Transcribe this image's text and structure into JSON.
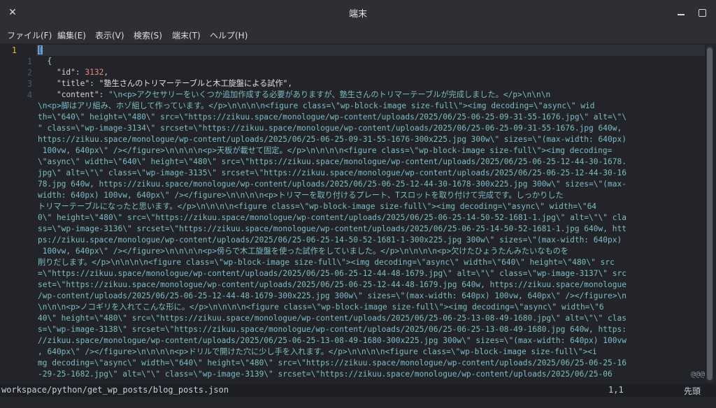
{
  "window": {
    "title": "端末"
  },
  "titlebar": {
    "close_glyph": "✕"
  },
  "menu": [
    "ファイル(F)",
    "編集(E)",
    "表示(V)",
    "検索(S)",
    "端末(T)",
    "ヘルプ(H)"
  ],
  "gutter": {
    "current_line": "1",
    "relative_numbers": [
      "1",
      "2",
      "3",
      "4"
    ]
  },
  "code": {
    "line1_bracket": "[",
    "line2": "  {",
    "line3_key": "\"id\"",
    "line3_sep": ": ",
    "line3_value": "3132",
    "line3_end": ",",
    "line4_key": "\"title\"",
    "line4_sep": ": ",
    "line4_value": "\"塾生さんのトリマーテーブルと木工旋盤による試作\"",
    "line4_end": ",",
    "line5_key": "\"content\"",
    "line5_sep": ": ",
    "line5_value": "\"\\n<p>アクセサリーをいくつか追加作成する必要がありますが、塾生さんのトリマーテーブルが完成しました。</p>\\n\\n\\n",
    "wrap_lines": [
      "\\n<p>脚はアリ組み、ホゾ組して作っています。</p>\\n\\n\\n\\n<figure class=\\\"wp-block-image size-full\\\"><img decoding=\\\"async\\\" wid",
      "th=\\\"640\\\" height=\\\"480\\\" src=\\\"https://zikuu.space/monologue/wp-content/uploads/2025/06/25-06-25-09-31-55-1676.jpg\\\" alt=\\\"\\",
      "\" class=\\\"wp-image-3134\\\" srcset=\\\"https://zikuu.space/monologue/wp-content/uploads/2025/06/25-06-25-09-31-55-1676.jpg 640w,",
      "https://zikuu.space/monologue/wp-content/uploads/2025/06/25-06-25-09-31-55-1676-300x225.jpg 300w\\\" sizes=\\\"(max-width: 640px)",
      " 100vw, 640px\\\" /></figure>\\n\\n\\n\\n<p>天板が載せて固定。</p>\\n\\n\\n\\n<figure class=\\\"wp-block-image size-full\\\"><img decoding=",
      "\\\"async\\\" width=\\\"640\\\" height=\\\"480\\\" src=\\\"https://zikuu.space/monologue/wp-content/uploads/2025/06/25-06-25-12-44-30-1678.",
      "jpg\\\" alt=\\\"\\\" class=\\\"wp-image-3135\\\" srcset=\\\"https://zikuu.space/monologue/wp-content/uploads/2025/06/25-06-25-12-44-30-16",
      "78.jpg 640w, https://zikuu.space/monologue/wp-content/uploads/2025/06/25-06-25-12-44-30-1678-300x225.jpg 300w\\\" sizes=\\\"(max-",
      "width: 640px) 100vw, 640px\\\" /></figure>\\n\\n\\n\\n<p>トリマーを取り付けるプレート、Tスロットを取り付けて完成です。しっかりした",
      "トリマーテーブルになったと思います。</p>\\n\\n\\n\\n<figure class=\\\"wp-block-image size-full\\\"><img decoding=\\\"async\\\" width=\\\"64",
      "0\\\" height=\\\"480\\\" src=\\\"https://zikuu.space/monologue/wp-content/uploads/2025/06/25-06-25-14-50-52-1681-1.jpg\\\" alt=\\\"\\\" cla",
      "ss=\\\"wp-image-3136\\\" srcset=\\\"https://zikuu.space/monologue/wp-content/uploads/2025/06/25-06-25-14-50-52-1681-1.jpg 640w, htt",
      "ps://zikuu.space/monologue/wp-content/uploads/2025/06/25-06-25-14-50-52-1681-1-300x225.jpg 300w\\\" sizes=\\\"(max-width: 640px)",
      " 100vw, 640px\\\" /></figure>\\n\\n\\n\\n<p>傍らで木工旋盤を使った試作をしていました。</p>\\n\\n\\n\\n<p>欠けたひょうたんみたいなものを",
      "削りだします。</p>\\n\\n\\n\\n<figure class=\\\"wp-block-image size-full\\\"><img decoding=\\\"async\\\" width=\\\"640\\\" height=\\\"480\\\" src",
      "=\\\"https://zikuu.space/monologue/wp-content/uploads/2025/06/25-06-25-12-44-48-1679.jpg\\\" alt=\\\"\\\" class=\\\"wp-image-3137\\\" src",
      "set=\\\"https://zikuu.space/monologue/wp-content/uploads/2025/06/25-06-25-12-44-48-1679.jpg 640w, https://zikuu.space/monologue",
      "/wp-content/uploads/2025/06/25-06-25-12-44-48-1679-300x225.jpg 300w\\\" sizes=\\\"(max-width: 640px) 100vw, 640px\\\" /></figure>\\n",
      "\\n\\n\\n<p>ノコギリを入れてこんな形に。</p>\\n\\n\\n\\n<figure class=\\\"wp-block-image size-full\\\"><img decoding=\\\"async\\\" width=\\\"6",
      "40\\\" height=\\\"480\\\" src=\\\"https://zikuu.space/monologue/wp-content/uploads/2025/06/25-06-25-13-08-49-1680.jpg\\\" alt=\\\"\\\" clas",
      "s=\\\"wp-image-3138\\\" srcset=\\\"https://zikuu.space/monologue/wp-content/uploads/2025/06/25-06-25-13-08-49-1680.jpg 640w, https:",
      "//zikuu.space/monologue/wp-content/uploads/2025/06/25-06-25-13-08-49-1680-300x225.jpg 300w\\\" sizes=\\\"(max-width: 640px) 100vw",
      ", 640px\\\" /></figure>\\n\\n\\n\\n<p>ドリルで開けた穴に少し手を入れます。</p>\\n\\n\\n\\n<figure class=\\\"wp-block-image size-full\\\"><i",
      "mg decoding=\\\"async\\\" width=\\\"640\\\" height=\\\"480\\\" src=\\\"https://zikuu.space/monologue/wp-content/uploads/2025/06/25-06-25-16",
      "-29-25-1682.jpg\\\" alt=\\\"\\\" class=\\\"wp-image-3139\\\" srcset=\\\"https://zikuu.space/monologue/wp-content/uploads/2025/06/25-06"
    ],
    "overflow_marker": "@@@"
  },
  "status": {
    "path": "workspace/python/get_wp_posts/blog_posts.json",
    "position": "1,1",
    "where": "先頭"
  }
}
